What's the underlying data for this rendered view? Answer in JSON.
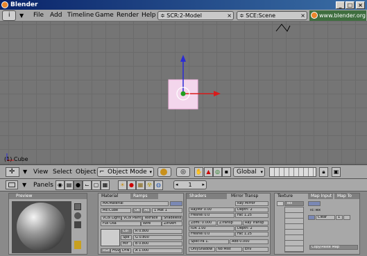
{
  "window": {
    "title": "Blender"
  },
  "menu": {
    "items": [
      "File",
      "Add",
      "Timeline",
      "Game",
      "Render",
      "Help"
    ]
  },
  "screen_selector": {
    "value": "SCR:2-Model"
  },
  "scene_selector": {
    "value": "SCE:Scene"
  },
  "website": {
    "label": "www.blender.org"
  },
  "viewport": {
    "object_label": "(1) Cube"
  },
  "view_header": {
    "menus": [
      "View",
      "Select",
      "Object"
    ],
    "mode": "Object Mode",
    "orientation": "Global"
  },
  "buttons_header": {
    "panels_label": "Panels",
    "frame": "1"
  },
  "panels": {
    "preview": {
      "title": "Preview"
    },
    "material": {
      "tabs": [
        "Material",
        "Ramps"
      ],
      "ma_name": "MA:Material",
      "me_name": "ME:Cube",
      "ob_label": "OB",
      "ma_label": "ME",
      "mat_index": "1 Mat 1",
      "toggles_row1": [
        "VCol Light",
        "VCol Paint",
        "TexFace",
        "Shadeless"
      ],
      "toggles_row2": [
        "Full Osa",
        "Wire",
        "ZInvert"
      ],
      "color_labels": [
        "Col",
        "Spe",
        "Mir"
      ],
      "rgb_values": [
        "R 0.800",
        "G 0.800",
        "B 0.800"
      ],
      "mode_buttons": [
        "RGB",
        "HSV",
        "DYN"
      ],
      "alpha": "A 1.000"
    },
    "shaders": {
      "tabs": [
        "Shaders",
        "Mirror Transp"
      ],
      "ray_mirror": "Ray Mirror",
      "raymir": "RayMir 0.00",
      "depth1": "Depth: 2",
      "fresnel1": "Fresnel 0.0",
      "fac1": "Fac 1.25",
      "zoffs": "Zoffs: 0.000",
      "ztransp": "ZTransp",
      "ray_transp": "Ray Transp",
      "ior": "IOR 1.00",
      "depth2": "Depth: 2",
      "fresnel2": "Fresnel 0.0",
      "fac2": "Fac 1.25",
      "specta": "SpecTra 1.",
      "add": "Add 0.000",
      "bottom": [
        "OnlyShadow",
        "No Mist",
        "Env"
      ]
    },
    "texture": {
      "tabs": [
        "Texture",
        "Map Input",
        "Map To"
      ],
      "tex_slot": "Tex",
      "te_name": "TE:Tex",
      "clear": "Clear",
      "users": "1",
      "copy": "Copy/Paste Map"
    }
  },
  "colors": {
    "accent": "#3a6ea5",
    "x_axis": "#d91b1b",
    "y_axis": "#2b2bd6",
    "selection": "#f0d0e8"
  }
}
